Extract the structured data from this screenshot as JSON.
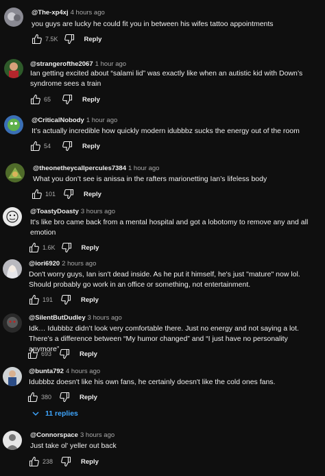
{
  "colors": {
    "background": "#0f0f0f",
    "text": "#f1f1f1",
    "muted": "#aaaaaa",
    "link": "#3ea6ff"
  },
  "icons": {
    "like": "thumbs-up-icon",
    "dislike": "thumbs-down-icon",
    "expand": "chevron-down-icon"
  },
  "comments": [
    {
      "author": "@The-xp4xj",
      "time": "4 hours ago",
      "text": "you guys are lucky he could fit you in between his wifes tattoo appointments",
      "likes": "7.5K",
      "reply_label": "Reply"
    },
    {
      "author": "@strangerofthe2067",
      "time": "1 hour ago",
      "text": "Ian getting excited about “salami lid” was exactly like when an autistic kid with Down’s syndrome sees a train",
      "likes": "65",
      "reply_label": "Reply"
    },
    {
      "author": "@CriticalNobody",
      "time": "1 hour ago",
      "text": "It’s actually incredible how quickly modern idubbbz sucks the energy out of the room",
      "likes": "54",
      "reply_label": "Reply"
    },
    {
      "author": "@theonetheycallpercules7384",
      "time": "1 hour ago",
      "text": "What you don’t see is anissa in the rafters marionetting Ian’s lifeless body",
      "likes": "101",
      "reply_label": "Reply"
    },
    {
      "author": "@ToastyDoasty",
      "time": "3 hours ago",
      "text": "It's like bro came back from a mental hospital and got a lobotomy to remove any and all emotion",
      "likes": "1.6K",
      "reply_label": "Reply"
    },
    {
      "author": "@iori6920",
      "time": "2 hours ago",
      "text": "Don't worry guys, Ian isn't dead inside. As he put it himself, he's just \"mature\" now lol. Should probably go work in an office or something, not entertainment.",
      "likes": "191",
      "reply_label": "Reply"
    },
    {
      "author": "@SilentButDudley",
      "time": "3 hours ago",
      "text": "Idk… Idubbbz didn’t look very comfortable there. Just no energy and not saying a lot. There’s a difference between “My humor changed” and “I just have no personality anymore”",
      "likes": "693",
      "reply_label": "Reply"
    },
    {
      "author": "@bunta792",
      "time": "4 hours ago",
      "text": "Idubbbz doesn't like his own fans, he certainly doesn't like the cold ones fans.",
      "likes": "380",
      "reply_label": "Reply",
      "replies_label": "11 replies"
    },
    {
      "author": "@Connorspace",
      "time": "3 hours ago",
      "text": "Just take ol' yeller out back",
      "likes": "238",
      "reply_label": "Reply"
    }
  ]
}
